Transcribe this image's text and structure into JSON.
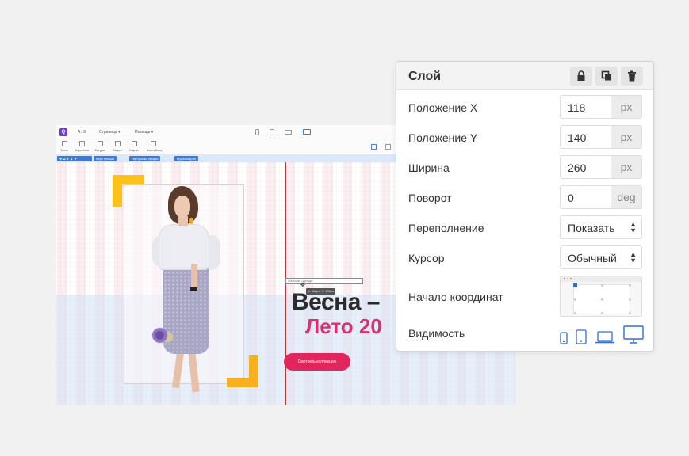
{
  "editor": {
    "topbar": {
      "logo": "Q",
      "ab": "A / B",
      "menu_page": "Страница",
      "menu_help": "Помощь"
    },
    "tools": [
      "Текст",
      "Картинки",
      "Фигуры",
      "Видео",
      "Карты",
      "Контейнер"
    ],
    "selection_chips": [
      "Верх секции",
      "Настройки секции",
      "Мультиэкран"
    ],
    "canvas": {
      "label_field": "Женская одежда",
      "coord_tip": "X: 118px, Y: 140px",
      "title": "Весна –",
      "subtitle": "Лето 20",
      "cta": "Смотреть коллекцию"
    },
    "colors": {
      "accent": "#e0265c",
      "brand": "#6b3fc8",
      "corner": "#fcc11a",
      "selection": "#3a7bdf"
    }
  },
  "panel": {
    "title": "Слой",
    "header_icons": [
      "lock-icon",
      "duplicate-icon",
      "trash-icon"
    ],
    "rows": {
      "pos_x": {
        "label": "Положение X",
        "value": "118",
        "unit": "px"
      },
      "pos_y": {
        "label": "Положение Y",
        "value": "140",
        "unit": "px"
      },
      "width": {
        "label": "Ширина",
        "value": "260",
        "unit": "px"
      },
      "rotation": {
        "label": "Поворот",
        "value": "0",
        "unit": "deg"
      },
      "overflow": {
        "label": "Переполнение",
        "value": "Показать"
      },
      "cursor": {
        "label": "Курсор",
        "value": "Обычный"
      },
      "origin": {
        "label": "Начало координат",
        "selected": "top-left"
      },
      "visibility": {
        "label": "Видимость",
        "devices": [
          "phone-icon",
          "tablet-icon",
          "laptop-icon",
          "desktop-icon"
        ]
      }
    },
    "colors": {
      "visibility_icon": "#2f6fd8"
    }
  }
}
